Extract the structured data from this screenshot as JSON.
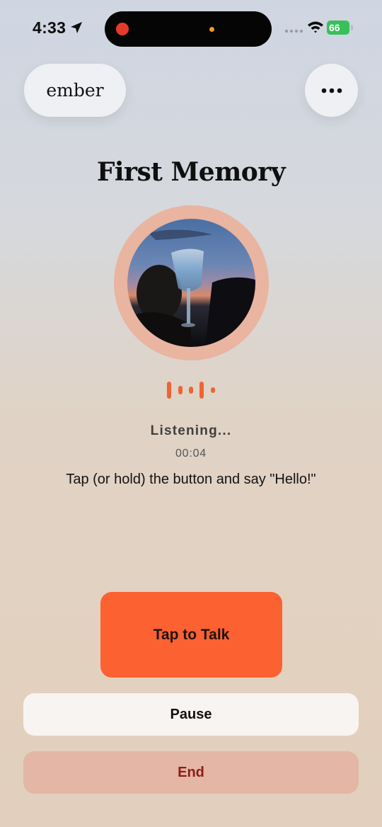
{
  "status_bar": {
    "time": "4:33",
    "battery_level": "66",
    "icons": [
      "location-arrow-icon",
      "cellular-signal-icon",
      "wifi-icon",
      "battery-charging-icon"
    ]
  },
  "header": {
    "brand_label": "ember",
    "more_icon": "ellipsis-icon"
  },
  "main": {
    "title": "First Memory",
    "status_label": "Listening...",
    "elapsed_time": "00:04",
    "instructions": "Tap (or hold) the button and say \"Hello!\""
  },
  "actions": {
    "talk_label": "Tap to Talk",
    "pause_label": "Pause",
    "end_label": "End"
  },
  "colors": {
    "accent": "#fc6132",
    "avatar_ring": "#e9b4a0",
    "end_background": "#e3b6a5",
    "end_text": "#8e1d16",
    "battery": "#38c159"
  }
}
